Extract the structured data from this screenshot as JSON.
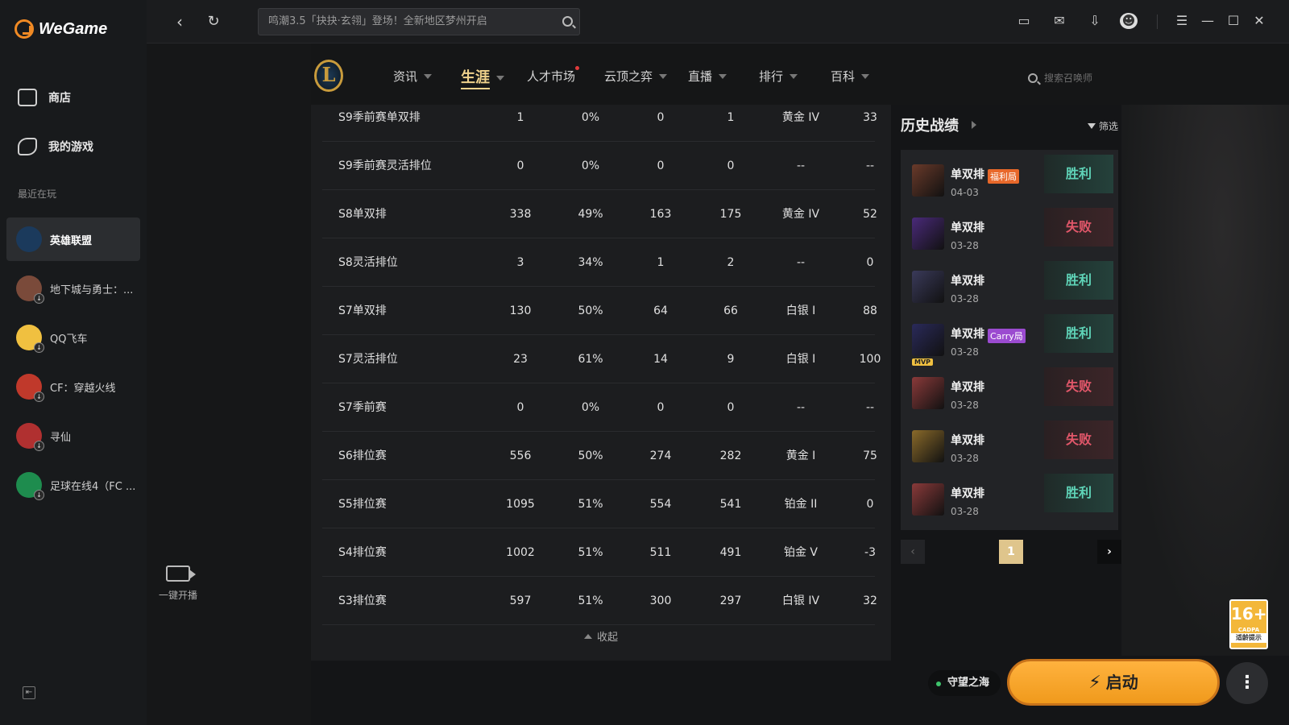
{
  "app": {
    "name": "WeGame"
  },
  "sidebar": {
    "nav": [
      {
        "label": "商店",
        "icon": "shop-icon"
      },
      {
        "label": "我的游戏",
        "icon": "gamepad-icon"
      }
    ],
    "recent_label": "最近在玩",
    "games": [
      {
        "label": "英雄联盟",
        "color": "#1b3a5c",
        "active": true
      },
      {
        "label": "地下城与勇士：...",
        "color": "#7a4a3a"
      },
      {
        "label": "QQ飞车",
        "color": "#f0c040"
      },
      {
        "label": "CF：穿越火线",
        "color": "#c0392b"
      },
      {
        "label": "寻仙",
        "color": "#b03030"
      },
      {
        "label": "足球在线4（FC ...",
        "color": "#1e8c4e"
      }
    ]
  },
  "topbar": {
    "search_text": "鸣潮3.5「抉抉·玄翎」登场！全新地区梦州开启"
  },
  "live": {
    "label": "一键开播"
  },
  "gamenav": {
    "logo_letter": "L",
    "tabs": [
      {
        "label": "资讯",
        "caret": true
      },
      {
        "label": "生涯",
        "caret": true,
        "active": true
      },
      {
        "label": "人才市场",
        "dot": true
      },
      {
        "label": "云顶之弈",
        "caret": true
      },
      {
        "label": "直播",
        "caret": true
      },
      {
        "label": "排行",
        "caret": true
      },
      {
        "label": "百科",
        "caret": true
      }
    ],
    "summoner_search": "搜索召唤师"
  },
  "stats": {
    "rows": [
      [
        "S9季前赛单双排",
        "1",
        "0%",
        "0",
        "1",
        "黄金 IV",
        "33"
      ],
      [
        "S9季前赛灵活排位",
        "0",
        "0%",
        "0",
        "0",
        "--",
        "--"
      ],
      [
        "S8单双排",
        "338",
        "49%",
        "163",
        "175",
        "黄金 IV",
        "52"
      ],
      [
        "S8灵活排位",
        "3",
        "34%",
        "1",
        "2",
        "--",
        "0"
      ],
      [
        "S7单双排",
        "130",
        "50%",
        "64",
        "66",
        "白银 I",
        "88"
      ],
      [
        "S7灵活排位",
        "23",
        "61%",
        "14",
        "9",
        "白银 I",
        "100"
      ],
      [
        "S7季前赛",
        "0",
        "0%",
        "0",
        "0",
        "--",
        "--"
      ],
      [
        "S6排位赛",
        "556",
        "50%",
        "274",
        "282",
        "黄金 I",
        "75"
      ],
      [
        "S5排位赛",
        "1095",
        "51%",
        "554",
        "541",
        "铂金 II",
        "0"
      ],
      [
        "S4排位赛",
        "1002",
        "51%",
        "511",
        "491",
        "铂金 V",
        "-3"
      ],
      [
        "S3排位赛",
        "597",
        "51%",
        "300",
        "297",
        "白银 IV",
        "32"
      ]
    ],
    "collapse_label": "收起"
  },
  "history": {
    "title": "历史战绩",
    "filter_label": "筛选",
    "matches": [
      {
        "mode": "单双排",
        "tag": "福利局",
        "tag_color": "#e8682a",
        "date": "04-03",
        "result": "胜利",
        "win": true,
        "champ_color": "#6a3a2a"
      },
      {
        "mode": "单双排",
        "date": "03-28",
        "result": "失败",
        "win": false,
        "champ_color": "#4a2a7a"
      },
      {
        "mode": "单双排",
        "date": "03-28",
        "result": "胜利",
        "win": true,
        "champ_color": "#3a3a5a"
      },
      {
        "mode": "单双排",
        "tag": "Carry局",
        "tag_color": "#9b4bd0",
        "date": "03-28",
        "result": "胜利",
        "win": true,
        "champ_color": "#2a2a5a",
        "mvp": "MVP"
      },
      {
        "mode": "单双排",
        "date": "03-28",
        "result": "失败",
        "win": false,
        "champ_color": "#8a3a3a"
      },
      {
        "mode": "单双排",
        "date": "03-28",
        "result": "失败",
        "win": false,
        "champ_color": "#8a6a2a"
      },
      {
        "mode": "单双排",
        "date": "03-28",
        "result": "胜利",
        "win": true,
        "champ_color": "#8a3a3a"
      }
    ],
    "page": "1"
  },
  "age_rating": {
    "number": "16+",
    "cadpa": "CADPA",
    "label": "适龄提示"
  },
  "server": {
    "label": "守望之海"
  },
  "launch": {
    "label": "启动"
  }
}
